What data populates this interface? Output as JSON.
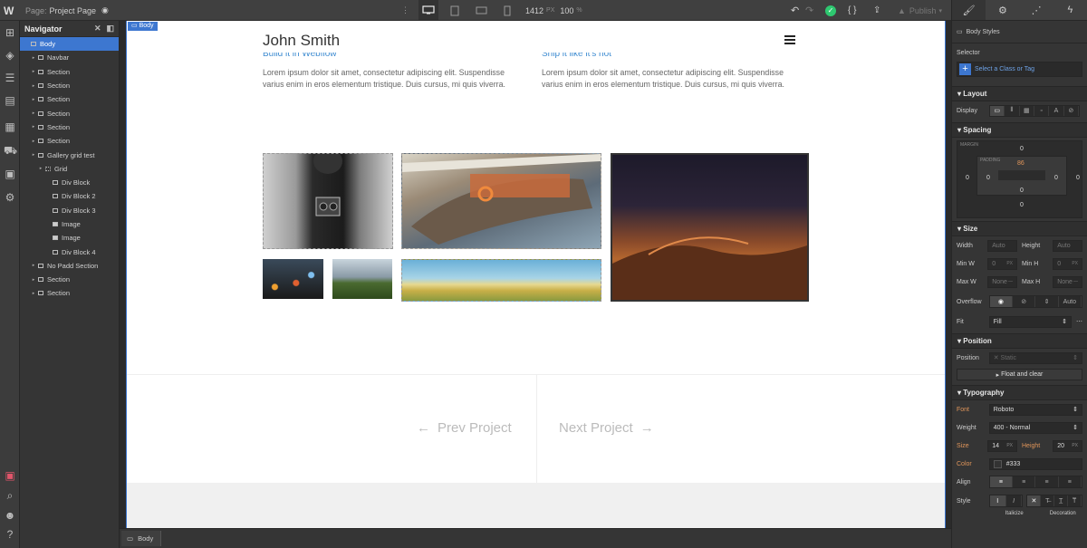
{
  "topbar": {
    "page_prefix": "Page:",
    "page_name": "Project Page",
    "canvas_width": "1412",
    "canvas_unit": "PX",
    "zoom": "100",
    "zoom_unit": "%",
    "publish_label": "Publish"
  },
  "navigator": {
    "title": "Navigator",
    "items": [
      {
        "label": "Body",
        "depth": 0,
        "icon": "body-icon",
        "selected": true
      },
      {
        "label": "Navbar",
        "depth": 1,
        "icon": "navbar-icon"
      },
      {
        "label": "Section",
        "depth": 1,
        "icon": "section-icon"
      },
      {
        "label": "Section",
        "depth": 1,
        "icon": "section-icon"
      },
      {
        "label": "Section",
        "depth": 1,
        "icon": "section-icon"
      },
      {
        "label": "Section",
        "depth": 1,
        "icon": "section-icon"
      },
      {
        "label": "Section",
        "depth": 1,
        "icon": "section-icon"
      },
      {
        "label": "Section",
        "depth": 1,
        "icon": "section-icon"
      },
      {
        "label": "Gallery grid test",
        "depth": 1,
        "icon": "section-icon"
      },
      {
        "label": "Grid",
        "depth": 2,
        "icon": "grid-icon"
      },
      {
        "label": "Div Block",
        "depth": 3,
        "icon": "div-icon"
      },
      {
        "label": "Div Block 2",
        "depth": 3,
        "icon": "div-icon"
      },
      {
        "label": "Div Block 3",
        "depth": 3,
        "icon": "div-icon"
      },
      {
        "label": "Image",
        "depth": 3,
        "icon": "image-icon"
      },
      {
        "label": "Image",
        "depth": 3,
        "icon": "image-icon"
      },
      {
        "label": "Div Block 4",
        "depth": 3,
        "icon": "div-icon"
      },
      {
        "label": "No Padd Section",
        "depth": 1,
        "icon": "section-icon"
      },
      {
        "label": "Section",
        "depth": 1,
        "icon": "section-icon"
      },
      {
        "label": "Section",
        "depth": 1,
        "icon": "section-icon"
      }
    ]
  },
  "canvas": {
    "body_tag": "Body",
    "brand": "John Smith",
    "col1_heading": "Build it in Webflow",
    "col2_heading": "Ship it like it's hot",
    "col1_text": "Lorem ipsum dolor sit amet, consectetur adipiscing elit. Suspendisse varius enim in eros elementum tristique. Duis cursus, mi quis viverra.",
    "col2_text": "Lorem ipsum dolor sit amet, consectetur adipiscing elit. Suspendisse varius enim in eros elementum tristique. Duis cursus, mi quis viverra.",
    "prev_label": "Prev Project",
    "next_label": "Next Project"
  },
  "breadcrumb": {
    "label": "Body"
  },
  "styles": {
    "header": "Body Styles",
    "selector_label": "Selector",
    "selector_placeholder": "Select a Class or Tag",
    "layout": {
      "title": "Layout",
      "display_label": "Display"
    },
    "spacing": {
      "title": "Spacing",
      "margin_label": "MARGIN",
      "padding_label": "PADDING",
      "margin": {
        "top": "0",
        "right": "0",
        "bottom": "0",
        "left": "0"
      },
      "padding": {
        "top": "86",
        "right": "0",
        "bottom": "0",
        "left": "0"
      }
    },
    "size": {
      "title": "Size",
      "width_label": "Width",
      "width_val": "Auto",
      "height_label": "Height",
      "height_val": "Auto",
      "minw_label": "Min W",
      "minw_val": "0",
      "minh_label": "Min H",
      "minh_val": "0",
      "maxw_label": "Max W",
      "maxw_val": "None",
      "maxh_label": "Max H",
      "maxh_val": "None",
      "px_unit": "PX",
      "overflow_label": "Overflow",
      "overflow_auto": "Auto",
      "fit_label": "Fit",
      "fit_val": "Fill"
    },
    "position": {
      "title": "Position",
      "position_label": "Position",
      "position_val": "Static",
      "float_label": "Float and clear"
    },
    "typography": {
      "title": "Typography",
      "font_label": "Font",
      "font_val": "Roboto",
      "weight_label": "Weight",
      "weight_val": "400 - Normal",
      "size_label": "Size",
      "size_val": "14",
      "size_unit": "PX",
      "height_label": "Height",
      "height_val": "20",
      "height_unit": "PX",
      "color_label": "Color",
      "color_val": "#333",
      "align_label": "Align",
      "style_label": "Style",
      "italicize_label": "Italicize",
      "decoration_label": "Decoration"
    }
  },
  "colors": {
    "accent": "#3d77d0",
    "green_check": "#2ec870",
    "orange_label": "#e0955a"
  }
}
